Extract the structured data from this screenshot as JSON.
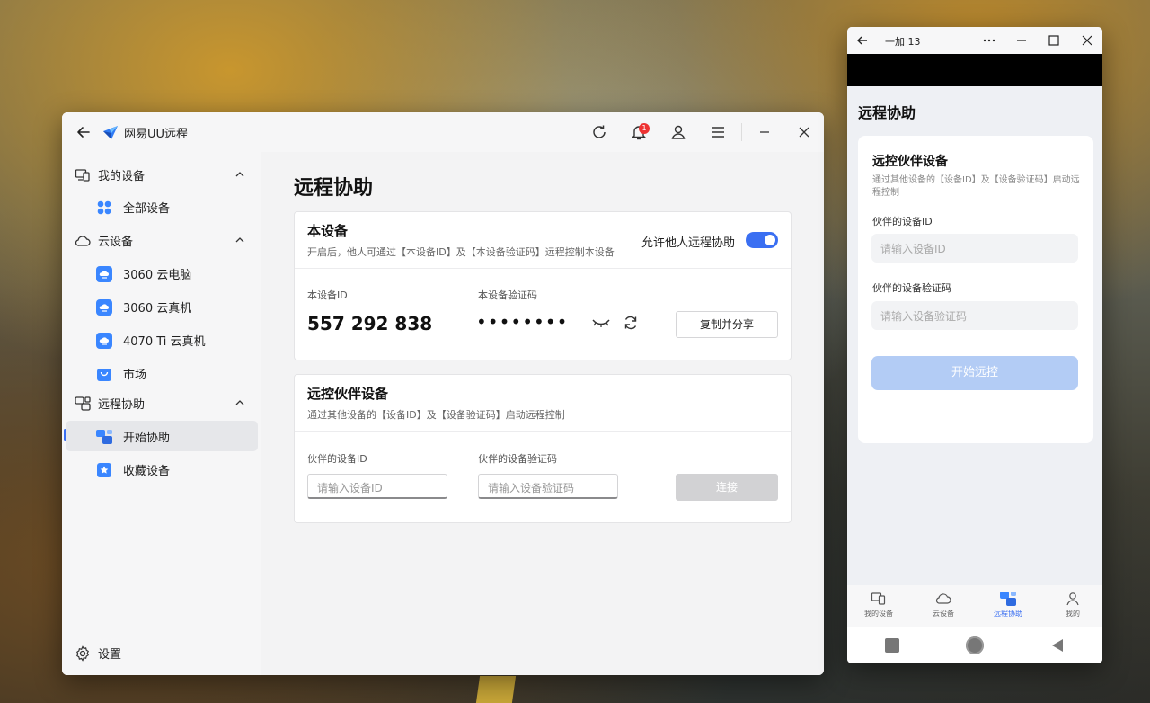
{
  "main_window": {
    "app_title": "网易UU远程",
    "notification_count": "1",
    "sidebar": {
      "groups": [
        {
          "label": "我的设备",
          "icon": "devices-icon"
        },
        {
          "label": "云设备",
          "icon": "cloud-icon"
        },
        {
          "label": "远程协助",
          "icon": "remote-assist-icon"
        }
      ],
      "items": [
        {
          "label": "全部设备",
          "icon": "grid-icon"
        },
        {
          "label": "3060 云电脑",
          "icon": "cloud-pc-icon"
        },
        {
          "label": "3060 云真机",
          "icon": "cloud-phone-icon"
        },
        {
          "label": "4070 Ti 云真机",
          "icon": "cloud-phone-icon"
        },
        {
          "label": "市场",
          "icon": "market-bag-icon"
        },
        {
          "label": "开始协助",
          "icon": "start-assist-icon"
        },
        {
          "label": "收藏设备",
          "icon": "star-bookmark-icon"
        }
      ],
      "settings_label": "设置",
      "active_item": "开始协助"
    },
    "page_title": "远程协助",
    "this_device": {
      "heading": "本设备",
      "subtitle": "开启后，他人可通过【本设备ID】及【本设备验证码】远程控制本设备",
      "allow_label": "允许他人远程协助",
      "allow_enabled": true,
      "id_label": "本设备ID",
      "id_value": "557 292 838",
      "code_label": "本设备验证码",
      "code_value": "••••••••",
      "copy_button": "复制并分享"
    },
    "partner": {
      "heading": "远控伙伴设备",
      "subtitle": "通过其他设备的【设备ID】及【设备验证码】启动远程控制",
      "id_label": "伙伴的设备ID",
      "id_placeholder": "请输入设备ID",
      "code_label": "伙伴的设备验证码",
      "code_placeholder": "请输入设备验证码",
      "connect_button": "连接"
    }
  },
  "phone_window": {
    "title": "一加 13",
    "page_title": "远程协助",
    "card_heading": "远控伙伴设备",
    "card_sub": "通过其他设备的【设备ID】及【设备验证码】启动远程控制",
    "id_label": "伙伴的设备ID",
    "id_placeholder": "请输入设备ID",
    "code_label": "伙伴的设备验证码",
    "code_placeholder": "请输入设备验证码",
    "start_button": "开始远控",
    "tabs": [
      "我的设备",
      "云设备",
      "远程协助",
      "我的"
    ],
    "active_tab": "远程协助"
  },
  "colors": {
    "accent": "#3a6ff2",
    "cloud_icon": "#3a86ff",
    "disabled_button": "#d2d2d4",
    "phone_button": "#b3ccf5"
  }
}
